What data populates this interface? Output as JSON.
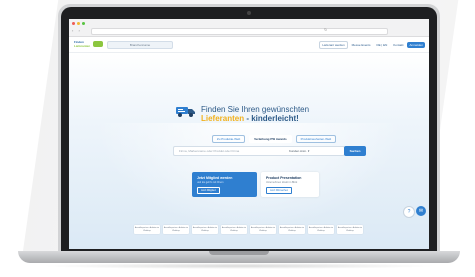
{
  "header": {
    "logo_line1": "Finden",
    "logo_line2": "Lieferanten",
    "logo_badge": "",
    "search_placeholder": "Branchenname",
    "actions": [
      "Lieferant werden",
      "Messe Events",
      "DE | EN",
      "Kontakt",
      "Anmelden"
    ]
  },
  "hero": {
    "headline_line1": "Finden Sie Ihren gewünschten",
    "headline_line2_a": "Lieferanten",
    "headline_line2_b": " - kinderleicht!",
    "tabs": [
      "Zu Produkte-Welt",
      "Verleihung PSI Awards",
      "Produktneuheiten-Welt"
    ],
    "active_tab_index": 1
  },
  "search": {
    "placeholder": "Firma, Markenname oder Produkt oder Firma",
    "select_label": "Kunden Anm. ▾",
    "button_label": "Suchen"
  },
  "cards": {
    "member": {
      "title": "Jetzt Mitglied werden",
      "text": "und los geht's mit Ihrem",
      "button": "Jetzt Mitglied"
    },
    "presentation": {
      "title": "Product Presentation",
      "text": "Unternehmen direkt im Blick",
      "button": "Jetzt Mitmachen"
    }
  },
  "partners": [
    "Ausstellerpartner • Anbieter im Webshop",
    "Ausstellerpartner • Anbieter im Webshop",
    "Ausstellerpartner • Anbieter im Webshop",
    "Ausstellerpartner • Anbieter im Webshop",
    "Ausstellerpartner • Anbieter im Webshop",
    "Ausstellerpartner • Anbieter im Webshop",
    "Ausstellerpartner • Anbieter im Webshop",
    "Ausstellerpartner • Anbieter im Webshop"
  ],
  "fabs": {
    "help_glyph": "?",
    "chat_glyph": "✉"
  },
  "colors": {
    "primary": "#2f7fd0",
    "accent_yellow": "#f2b11d",
    "accent_green": "#8cc63f",
    "headline_blue": "#2d5a87"
  }
}
